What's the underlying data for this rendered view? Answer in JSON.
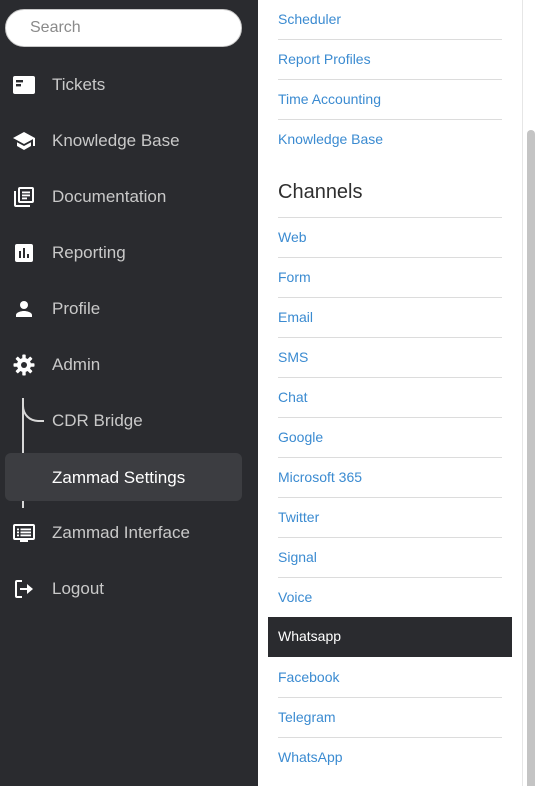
{
  "search": {
    "placeholder": "Search"
  },
  "sidebar": {
    "items": [
      {
        "label": "Tickets",
        "icon": "ticket-icon"
      },
      {
        "label": "Knowledge Base",
        "icon": "graduation-cap-icon"
      },
      {
        "label": "Documentation",
        "icon": "library-books-icon"
      },
      {
        "label": "Reporting",
        "icon": "bar-chart-icon"
      },
      {
        "label": "Profile",
        "icon": "person-icon"
      },
      {
        "label": "Admin",
        "icon": "gear-icon"
      }
    ],
    "admin_children": [
      {
        "label": "CDR Bridge"
      },
      {
        "label": "Zammad Settings",
        "active": true
      }
    ],
    "bottom_items": [
      {
        "label": "Zammad Interface",
        "icon": "monitor-list-icon"
      },
      {
        "label": "Logout",
        "icon": "logout-icon"
      }
    ]
  },
  "main": {
    "top_links": [
      "Scheduler",
      "Report Profiles",
      "Time Accounting",
      "Knowledge Base"
    ],
    "channels_title": "Channels",
    "channels": [
      "Web",
      "Form",
      "Email",
      "SMS",
      "Chat",
      "Google",
      "Microsoft 365",
      "Twitter",
      "Signal",
      "Voice",
      "Whatsapp",
      "Facebook",
      "Telegram",
      "WhatsApp"
    ],
    "selected_channel": "Whatsapp"
  },
  "colors": {
    "sidebar_bg": "#2a2b2f",
    "active_item_bg": "#3c3d41",
    "link": "#3b8bd1",
    "selected_bg": "#2a2b2f"
  }
}
